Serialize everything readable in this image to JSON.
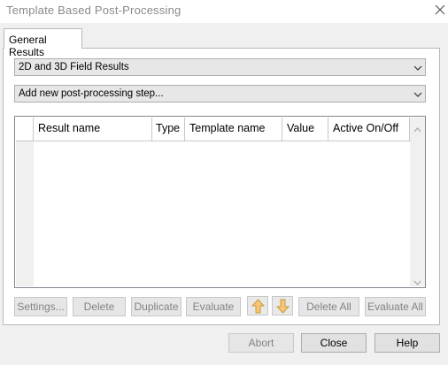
{
  "window": {
    "title": "Template Based Post-Processing"
  },
  "tabs": [
    {
      "label": "General Results"
    }
  ],
  "result_type_combo": {
    "value": "2D and 3D Field Results"
  },
  "add_step_combo": {
    "value": "Add new post-processing step..."
  },
  "table": {
    "columns": [
      "Result name",
      "Type",
      "Template name",
      "Value",
      "Active On/Off"
    ],
    "rows": []
  },
  "actions": {
    "settings": "Settings...",
    "delete": "Delete",
    "duplicate": "Duplicate",
    "evaluate": "Evaluate",
    "move_up_icon": "arrow-up-icon",
    "move_down_icon": "arrow-down-icon",
    "delete_all": "Delete All",
    "evaluate_all": "Evaluate All"
  },
  "dialog_buttons": {
    "abort": "Abort",
    "close": "Close",
    "help": "Help"
  },
  "colors": {
    "arrow_fill": "#f7c677",
    "arrow_stroke": "#c89a3c",
    "disabled_text": "#838383"
  }
}
